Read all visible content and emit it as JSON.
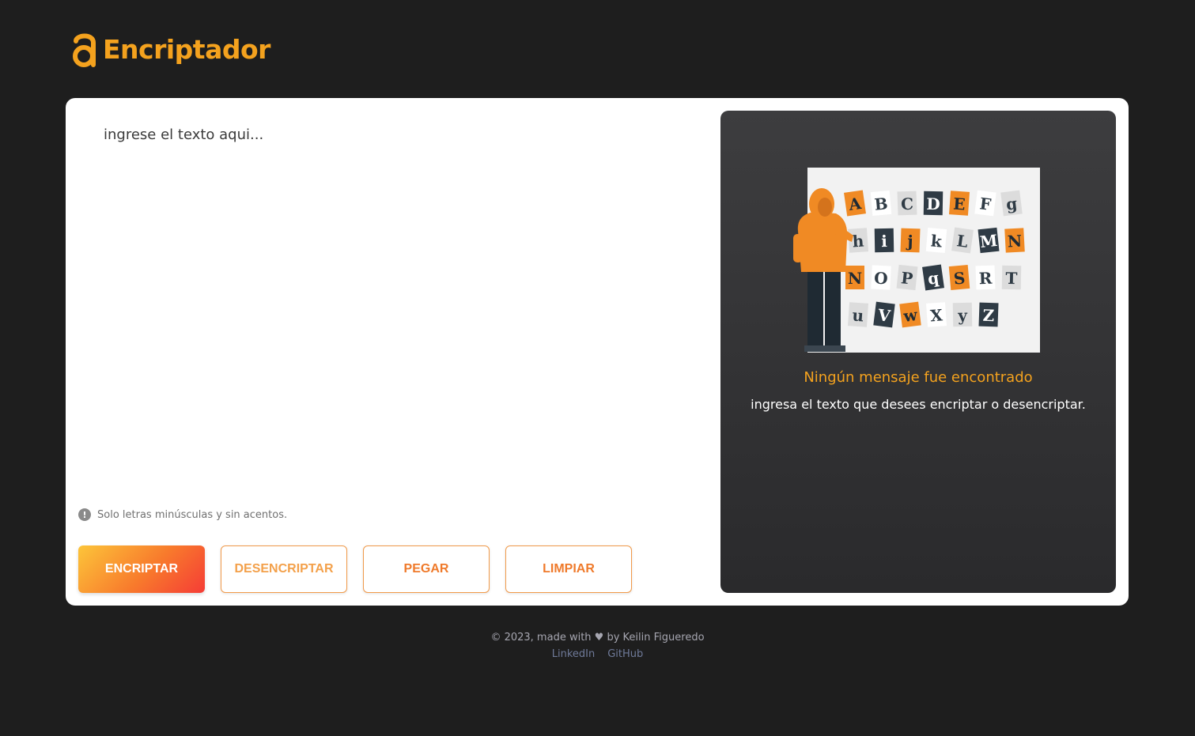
{
  "header": {
    "logo_text": "Encriptador",
    "logo_icon": "letter-a-icon"
  },
  "input": {
    "placeholder": "ingrese el texto aqui...",
    "value": ""
  },
  "hint": {
    "text": "Solo letras minúsculas y sin acentos.",
    "icon": "exclamation-icon"
  },
  "buttons": {
    "encrypt": "ENCRIPTAR",
    "decrypt": "DESENCRIPTAR",
    "paste": "PEGAR",
    "clear": "LIMPIAR"
  },
  "output": {
    "title": "Ningún mensaje fue encontrado",
    "subtitle": "ingresa el texto que desees encriptar o desencriptar."
  },
  "illustration_letters": [
    "A",
    "B",
    "C",
    "D",
    "E",
    "F",
    "g",
    "h",
    "i",
    "j",
    "k",
    "L",
    "M",
    "N",
    "N",
    "O",
    "P",
    "q",
    "S",
    "R",
    "T",
    "u",
    "V",
    "w",
    "X",
    "y",
    "Z"
  ],
  "footer": {
    "prefix": "© 2023, made with",
    "suffix": "by Keilin Figueredo",
    "links": [
      "LinkedIn",
      "GitHub"
    ]
  },
  "colors": {
    "accent": "#f4a21e",
    "background": "#1e1e1e",
    "panel": "#333335"
  }
}
